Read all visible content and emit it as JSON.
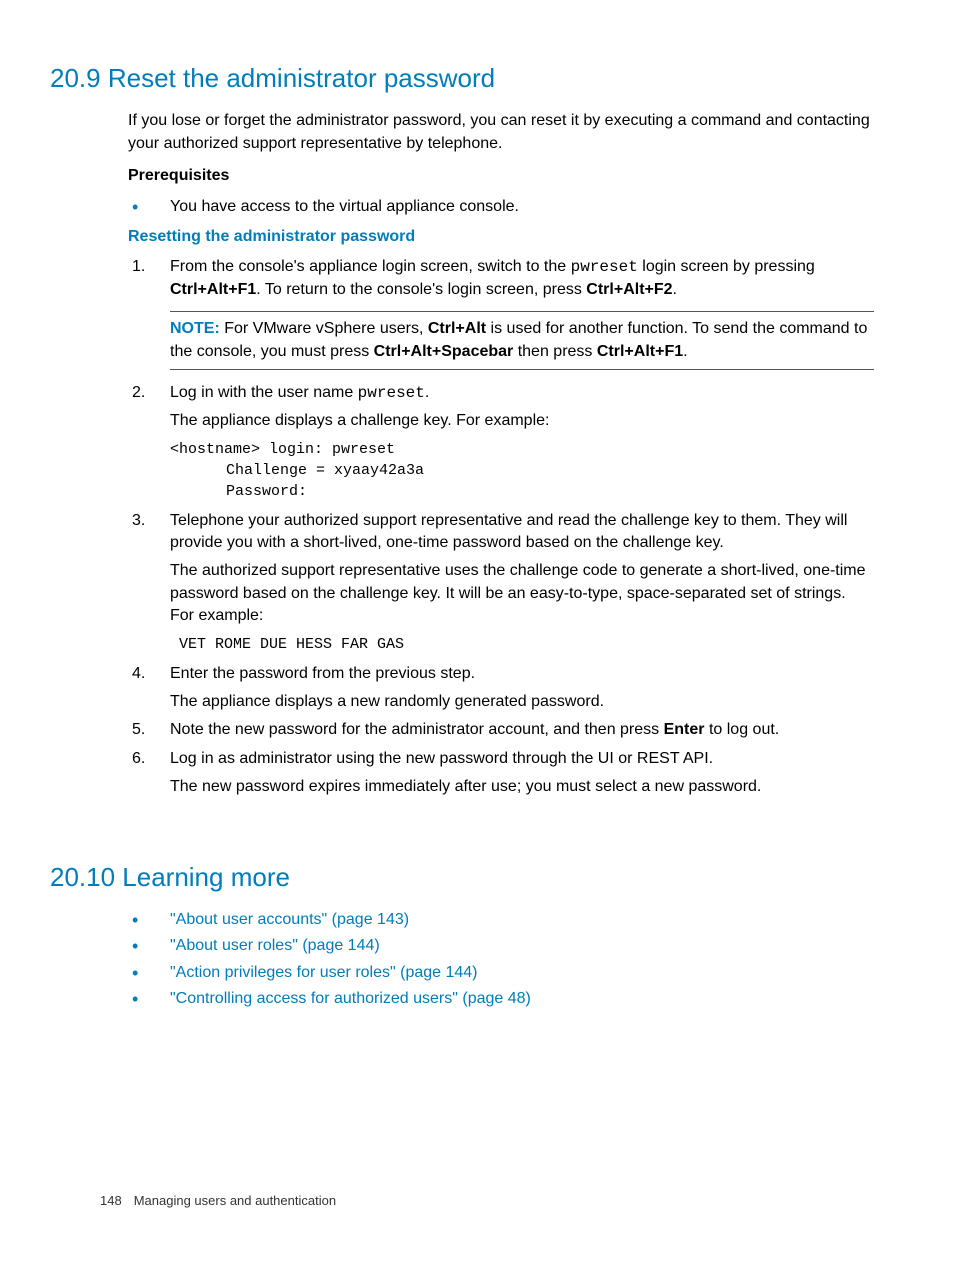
{
  "section1": {
    "heading": "20.9 Reset the administrator password",
    "intro": "If you lose or forget the administrator password, you can reset it by executing a command and contacting your authorized support representative by telephone.",
    "prereq_title": "Prerequisites",
    "prereq_item": "You have access to the virtual appliance console.",
    "sub_title": "Resetting the administrator password",
    "step1_a": "From the console's appliance login screen, switch to the ",
    "step1_code": "pwreset",
    "step1_b": " login screen by pressing ",
    "step1_key1": "Ctrl+Alt+F1",
    "step1_c": ". To return to the console's login screen, press ",
    "step1_key2": "Ctrl+Alt+F2",
    "step1_d": ".",
    "note_label": "NOTE:",
    "note_a": "   For VMware vSphere users, ",
    "note_key1": "Ctrl+Alt",
    "note_b": " is used for another function. To send the command to the console, you must press ",
    "note_key2": "Ctrl+Alt+Spacebar",
    "note_c": " then press ",
    "note_key3": "Ctrl+Alt+F1",
    "note_d": ".",
    "step2_a": "Log in with the user name ",
    "step2_code": "pwreset",
    "step2_b": ".",
    "step2_para": "The appliance displays a challenge key. For example:",
    "code1_l1": "<hostname> login: pwreset",
    "code1_l2": "Challenge = xyaay42a3a",
    "code1_l3": "Password:",
    "step3_a": "Telephone your authorized support representative and read the challenge key to them. They will provide you with a short-lived, one-time password based on the challenge key.",
    "step3_b": "The authorized support representative uses the challenge code to generate a short-lived, one-time password based on the challenge key. It will be an easy-to-type, space-separated set of strings. For example:",
    "code2": " VET ROME DUE HESS FAR GAS",
    "step4_a": "Enter the password from the previous step.",
    "step4_b": "The appliance displays a new randomly generated password.",
    "step5_a": "Note the new password for the administrator account, and then press ",
    "step5_key": "Enter",
    "step5_b": " to log out.",
    "step6_a": "Log in as administrator using the new password through the UI or REST API.",
    "step6_b": "The new password expires immediately after use; you must select a new password."
  },
  "section2": {
    "heading": "20.10 Learning more",
    "links": [
      "\"About user accounts\" (page 143)",
      "\"About user roles\" (page 144)",
      "\"Action privileges for user roles\" (page 144)",
      "\"Controlling access for authorized users\" (page 48)"
    ]
  },
  "footer": {
    "page": "148",
    "title": "Managing users and authentication"
  }
}
